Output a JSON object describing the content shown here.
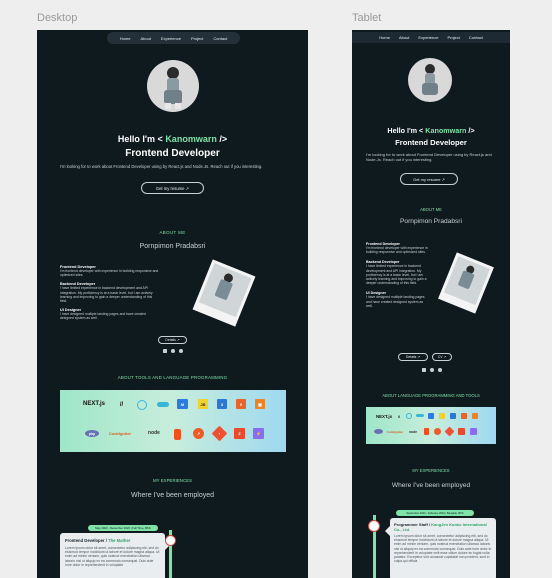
{
  "labels": {
    "desktop": "Desktop",
    "tablet": "Tablet"
  },
  "nav": [
    "Home",
    "About",
    "Experience",
    "Project",
    "Contact"
  ],
  "hero": {
    "hello_prefix": "Hello I'm < ",
    "name": "Kanomwarn",
    "hello_suffix": " />",
    "role": "Frontend Developer",
    "intro": "I'm looking for to work about Frontend Developer using by React.js and Node.Js. Reach out if you interesting.",
    "cta": "Get my resume ↗"
  },
  "about": {
    "heading": "ABOUT ME",
    "name": "Pornpimon Pradabsri",
    "skills": [
      {
        "title": "Frontend Developer",
        "text": "I'm frontend developer with experience in building responsive and optimized sites."
      },
      {
        "title": "Backend Developer",
        "text": "I have limited experience in backend development and API integration. My proficiency is at a basic level, but I am actively learning and improving to gain a deeper understanding of this field."
      },
      {
        "title": "UI Designer",
        "text": "I have designed multiple landing pages and have created designed system as well."
      }
    ],
    "details_btn": "Details ↗",
    "tab_btn1": "Details ↗",
    "tab_btn2": "CV ↗"
  },
  "tools": {
    "heading_desktop": "ABOUT TOOLS AND LANGUAGE PROGRAMMING",
    "heading_tablet": "ABOUT LANGUAGE PROGRAMMING AND TOOLS",
    "row1": [
      "NEXT.js",
      "//",
      "React",
      "Tailwind",
      "MUI",
      "JS",
      "CSS",
      "HTML",
      "Figma"
    ],
    "row2": [
      "php",
      "CodeIgniter",
      "node",
      "Figma",
      "Postman",
      "Git",
      "Zustand",
      "Vite"
    ]
  },
  "experience": {
    "heading": "MY EXPERIENCES",
    "title": "Where I've been employed",
    "desk_badge": "May 2023 - December 2023 | Full Time, BKK",
    "desk_role": "Frontend Developer /",
    "desk_company": "The Mather",
    "desk_text": "Lorem ipsum dolor sit amet, consectetur adipiscing elit, sed do eiusmod tempor incididunt ut labore et dolore magna aliqua. Ut enim ad minim veniam, quis nostrud exercitation ullamco laboris nisi ut aliquip ex ea commodo consequat. Duis aute irure dolor in reprehenderit in voluptate",
    "tab_badge": "September 2023 - February 2024 | Bangkok, BKK",
    "tab_role": "Programmer Staff /",
    "tab_company": "KangJen Konko International Co., Ltd.",
    "tab_text": "Lorem ipsum dolor sit amet, consectetur adipiscing elit, sed do eiusmod tempor incididunt ut labore et dolore magna aliqua. Ut enim ad minim veniam, quis nostrud exercitation ullamco laboris nisi ut aliquip ex ea commodo consequat. Duis aute irure dolor in reprehenderit in voluptate velit esse cillum dolore eu fugiat nulla pariatur. Excepteur sint occaecat cupidatat non proident, sunt in culpa qui officia"
  },
  "colors": {
    "bg": "#0f1a1f",
    "accent": "#7fe3a8"
  }
}
